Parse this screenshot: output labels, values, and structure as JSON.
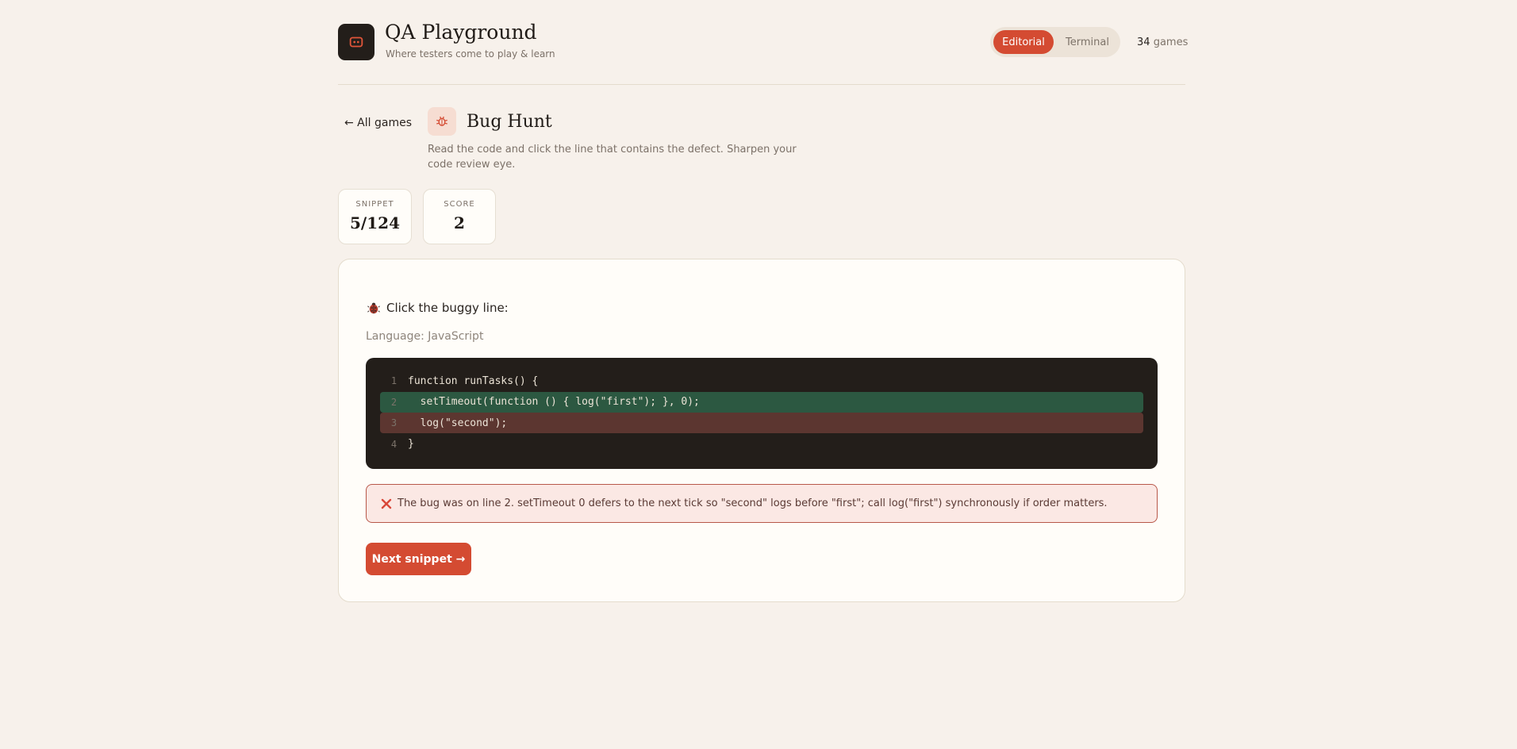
{
  "brand": {
    "title": "QA Playground",
    "subtitle": "Where testers come to play & learn"
  },
  "mode_toggle": {
    "options": [
      "Editorial",
      "Terminal"
    ],
    "selected": "Editorial"
  },
  "games_count": {
    "number": "34",
    "label": "games"
  },
  "game": {
    "back_label": "← All games",
    "title": "Bug Hunt",
    "description": "Read the code and click the line that contains the defect. Sharpen your code review eye."
  },
  "stats": [
    {
      "label": "SNIPPET",
      "value": "5/124"
    },
    {
      "label": "SCORE",
      "value": "2"
    }
  ],
  "challenge": {
    "prompt": "Click the buggy line:",
    "language": "Language: JavaScript",
    "lines": [
      {
        "num": "1",
        "text": "function runTasks() {",
        "state": "normal"
      },
      {
        "num": "2",
        "text": "  setTimeout(function () { log(\"first\"); }, 0);",
        "state": "correct"
      },
      {
        "num": "3",
        "text": "  log(\"second\");",
        "state": "wrong"
      },
      {
        "num": "4",
        "text": "}",
        "state": "normal"
      }
    ],
    "feedback": "The bug was on line 2. setTimeout 0 defers to the next tick so \"second\" logs before \"first\"; call log(\"first\") synchronously if order matters.",
    "next_label": "Next snippet →"
  },
  "colors": {
    "accent": "#d44b32",
    "background": "#f7f1eb",
    "code_bg": "#231e1a",
    "correct_line": "#2c5841",
    "wrong_line": "#5c3630"
  }
}
